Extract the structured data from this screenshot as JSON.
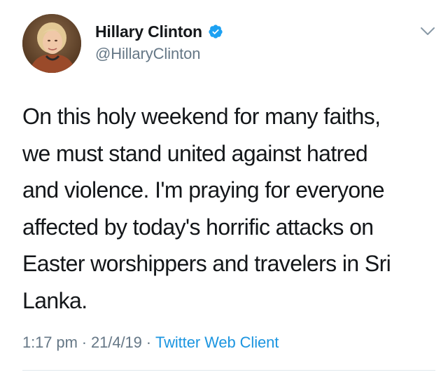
{
  "tweet": {
    "author": {
      "display_name": "Hillary Clinton",
      "handle": "@HillaryClinton",
      "verified": true,
      "avatar_icon": "profile-photo"
    },
    "text_lines": [
      "On this holy weekend for many faiths,",
      "we must stand united against hatred",
      "and violence. I'm praying for everyone",
      "affected by today's horrific attacks on",
      "Easter worshippers and travelers in Sri",
      "Lanka."
    ],
    "meta": {
      "time": "1:17 pm",
      "date": "21/4/19",
      "source": "Twitter Web Client",
      "separator": "·"
    },
    "menu_icon": "chevron-down-icon"
  },
  "colors": {
    "text": "#14171a",
    "secondary": "#657786",
    "link": "#1b95e0",
    "verified": "#1da1f2"
  }
}
